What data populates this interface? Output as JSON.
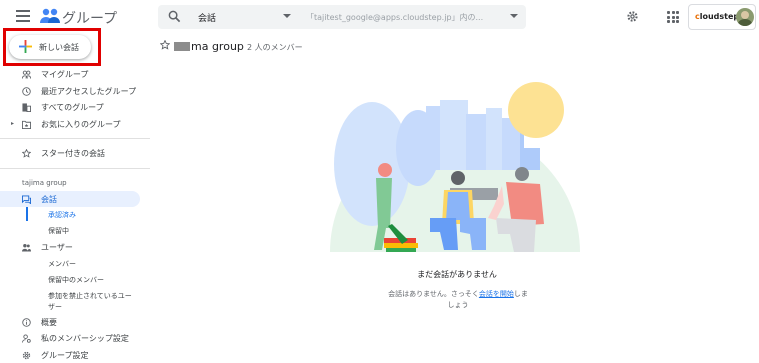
{
  "app": {
    "title": "グループ"
  },
  "search": {
    "scope": "会話",
    "query": "「tajitest_google@apps.cloudstep.jp」内の..."
  },
  "account": {
    "brand_prefix": "c",
    "brand_rest": "loudstep"
  },
  "new_chat": {
    "label": "新しい会話"
  },
  "nav": {
    "my_groups": "マイグループ",
    "recent": "最近アクセスしたグループ",
    "all": "すべてのグループ",
    "favorites": "お気に入りのグループ",
    "starred": "スター付きの会話"
  },
  "group_section": {
    "title": "tajima group",
    "conversations": "会話",
    "approved": "承認済み",
    "pending": "保留中",
    "users": "ユーザー",
    "members": "メンバー",
    "pending_members": "保留中のメンバー",
    "banned": "参加を禁止されているユーザー",
    "overview": "概要",
    "membership_settings": "私のメンバーシップ設定",
    "group_settings": "グループ設定"
  },
  "header": {
    "group_name": "ma group",
    "member_count": "2 人のメンバー"
  },
  "empty": {
    "title": "まだ会話がありません",
    "desc_before": "会話はありません。さっそく",
    "desc_link": "会話を開始",
    "desc_after": "しましょう"
  },
  "colors": {
    "accent": "#1a73e8",
    "highlight": "#e00000"
  }
}
